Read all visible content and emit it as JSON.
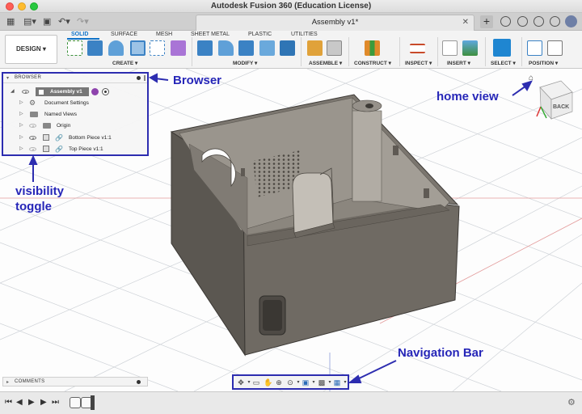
{
  "app": {
    "title": "Autodesk Fusion 360 (Education License)",
    "document_tab": "Assembly v1*"
  },
  "toolbar": {
    "workspace": "DESIGN ▾",
    "mode_tabs": [
      "SOLID",
      "SURFACE",
      "MESH",
      "SHEET METAL",
      "PLASTIC",
      "UTILITIES"
    ],
    "active_mode": "SOLID",
    "groups": [
      "CREATE ▾",
      "MODIFY ▾",
      "ASSEMBLE ▾",
      "CONSTRUCT ▾",
      "INSPECT ▾",
      "INSERT ▾",
      "SELECT ▾",
      "POSITION ▾"
    ]
  },
  "browser": {
    "title": "BROWSER",
    "root": "Assembly v1",
    "items": [
      "Document Settings",
      "Named Views",
      "Origin",
      "Bottom Piece v1:1",
      "Top Piece v1:1"
    ]
  },
  "comments": {
    "title": "COMMENTS"
  },
  "view_cube": {
    "face_label": "BACK"
  },
  "annotations": {
    "browser": "Browser",
    "visibility_line1": "visibility",
    "visibility_line2": "toggle",
    "home_view": "home view",
    "navigation_bar": "Navigation Bar"
  },
  "colors": {
    "accent": "#0f72c8",
    "annotation": "#2d2db0",
    "model_body": "#6f6a63"
  }
}
